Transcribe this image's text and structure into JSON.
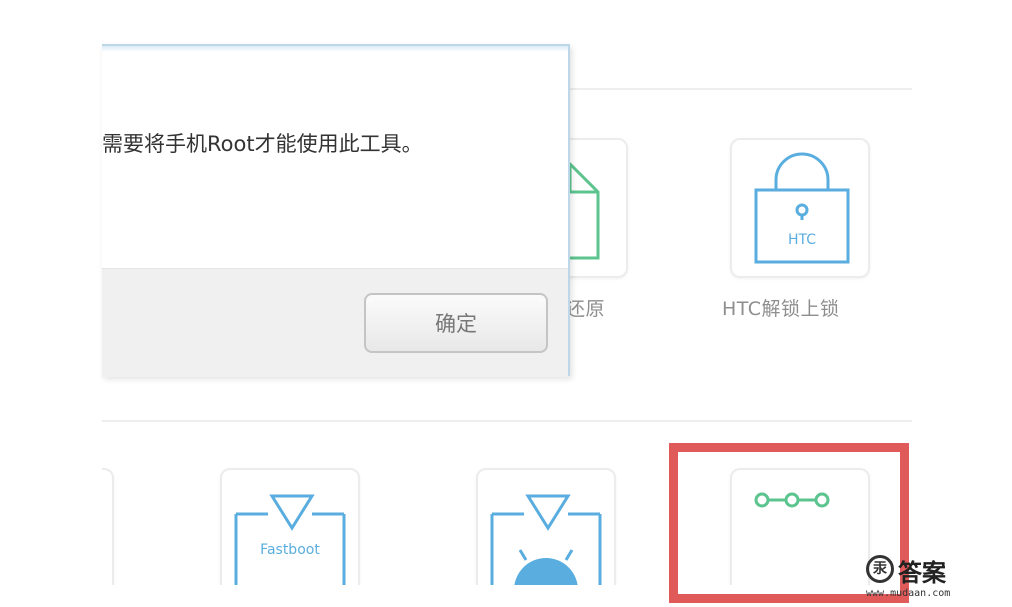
{
  "dialog": {
    "message": "需要将手机Root才能使用此工具。",
    "ok_label": "确定"
  },
  "tools": {
    "row1": [
      {
        "label": "还原",
        "icon": "file-restore-icon"
      },
      {
        "label": "HTC解锁上锁",
        "icon": "padlock-icon",
        "badge": "HTC"
      }
    ],
    "row2": [
      {
        "label": "",
        "icon": "fastboot-icon",
        "badge": "Fastboot"
      },
      {
        "label": "",
        "icon": "android-recovery-icon"
      },
      {
        "label": "",
        "icon": "three-nodes-icon",
        "selected": true
      }
    ]
  },
  "watermark": {
    "seal": "汞",
    "text": "答案",
    "url": "www.mudaan.com"
  },
  "colors": {
    "accent_blue": "#5aaedf",
    "accent_green": "#5cc48f",
    "highlight_red": "#e05a5a",
    "dialog_border": "#bcd7e8"
  }
}
